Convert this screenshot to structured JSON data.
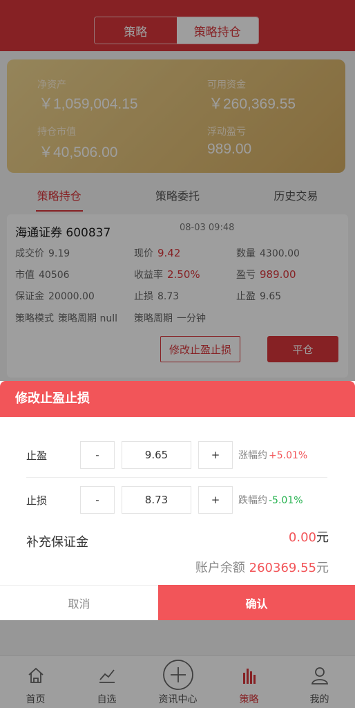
{
  "header": {
    "segments": [
      "策略",
      "策略持仓"
    ],
    "active_segment": "策略持仓"
  },
  "assets": {
    "net_assets_label": "净资产",
    "net_assets_value": "￥1,059,004.15",
    "available_label": "可用资金",
    "available_value": "￥260,369.55",
    "market_value_label": "持仓市值",
    "market_value_value": "￥40,506.00",
    "floating_pnl_label": "浮动盈亏",
    "floating_pnl_value": "989.00"
  },
  "tabs": [
    {
      "label": "策略持仓",
      "active": true
    },
    {
      "label": "策略委托",
      "active": false
    },
    {
      "label": "历史交易",
      "active": false
    }
  ],
  "position": {
    "stock": "海通证券 600837",
    "time": "08-03 09:48",
    "fields": {
      "deal_price_label": "成交价",
      "deal_price": "9.19",
      "current_price_label": "现价",
      "current_price": "9.42",
      "qty_label": "数量",
      "qty": "4300.00",
      "market_value_label": "市值",
      "market_value": "40506",
      "yield_label": "收益率",
      "yield": "2.50%",
      "pnl_label": "盈亏",
      "pnl": "989.00",
      "deposit_label": "保证金",
      "deposit": "20000.00",
      "stop_loss_label": "止损",
      "stop_loss": "8.73",
      "take_profit_label": "止盈",
      "take_profit": "9.65",
      "mode_label": "策略模式",
      "mode": "策略周期 null",
      "period_label": "策略周期",
      "period": "一分钟"
    },
    "edit_button": "修改止盈止损",
    "close_button": "平仓"
  },
  "modal": {
    "title": "修改止盈止损",
    "take_profit": {
      "label": "止盈",
      "minus": "-",
      "value": "9.65",
      "plus": "+",
      "pct_label": "涨幅约",
      "pct_value": "+5.01%"
    },
    "stop_loss": {
      "label": "止损",
      "minus": "-",
      "value": "8.73",
      "plus": "+",
      "pct_label": "跌幅约",
      "pct_value": "-5.01%"
    },
    "margin_label": "补充保证金",
    "margin_value": "0.00",
    "margin_unit": "元",
    "balance_label": "账户余额",
    "balance_value": "260369.55",
    "balance_unit": "元",
    "cancel": "取消",
    "confirm": "确认"
  },
  "tabbar": {
    "items": [
      {
        "label": "首页",
        "icon": "home-icon"
      },
      {
        "label": "自选",
        "icon": "chart-icon"
      },
      {
        "label": "资讯中心",
        "icon": "plus-circle-icon"
      },
      {
        "label": "策略",
        "icon": "bars-icon",
        "active": true
      },
      {
        "label": "我的",
        "icon": "user-icon"
      }
    ]
  },
  "colors": {
    "brand_red": "#d8363b",
    "modal_red": "#f25559",
    "gold": "#d6ae63",
    "green": "#22b14c"
  }
}
